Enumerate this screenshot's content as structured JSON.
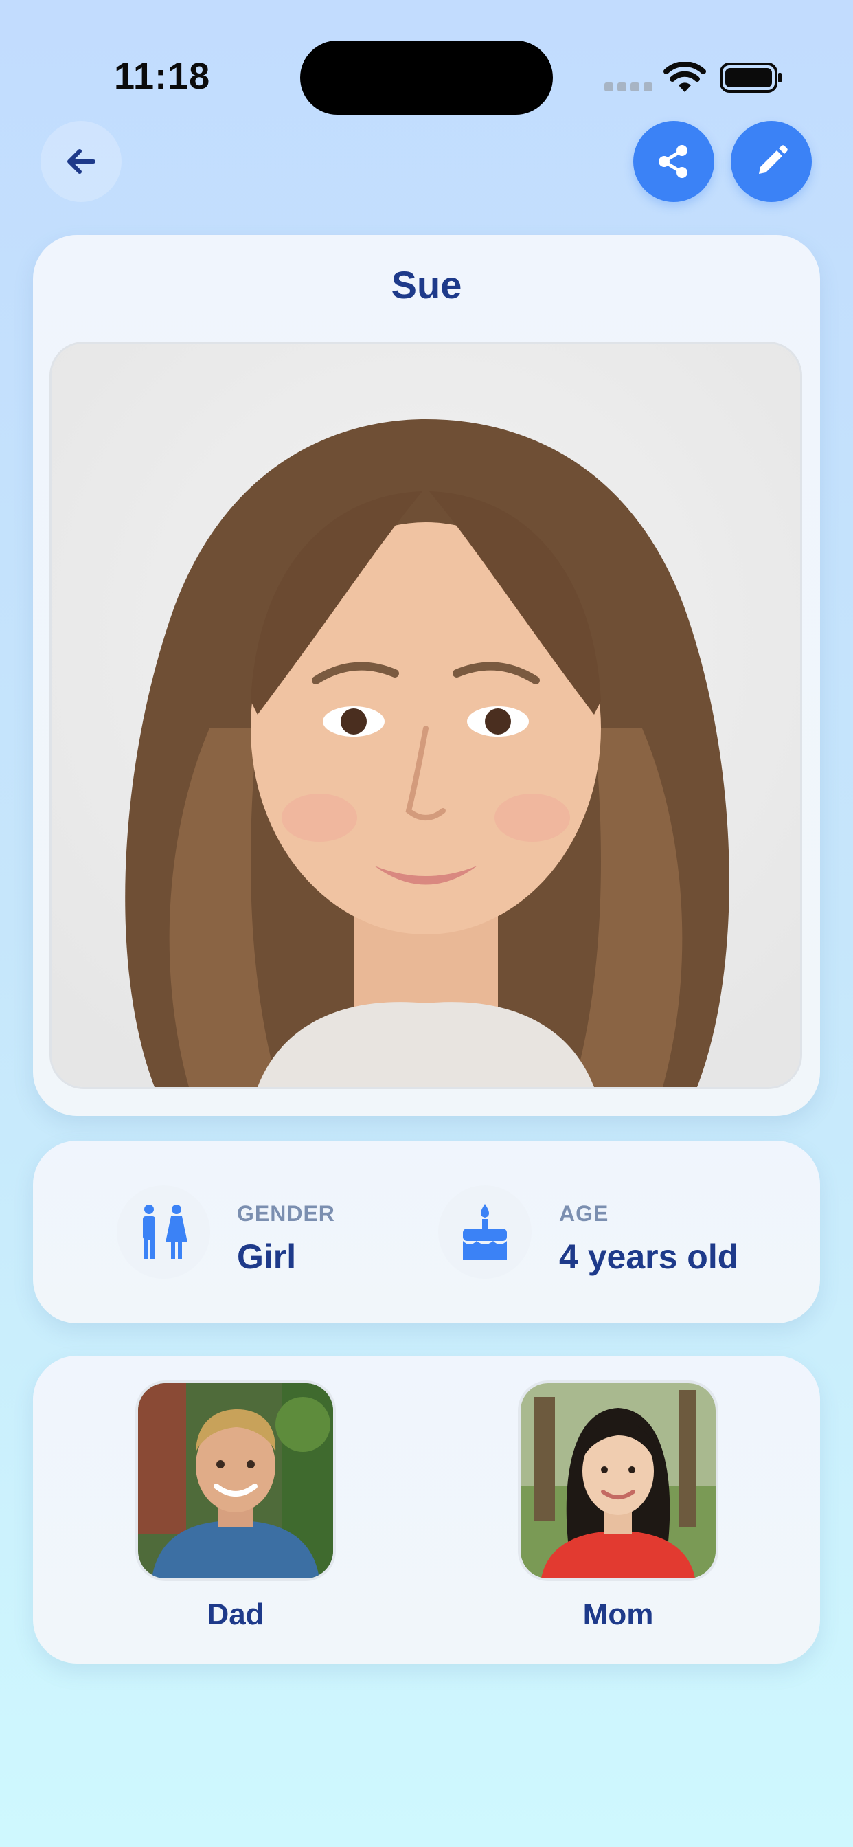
{
  "status_bar": {
    "time": "11:18"
  },
  "child": {
    "name": "Sue"
  },
  "info": {
    "gender_label": "GENDER",
    "gender_value": "Girl",
    "age_label": "AGE",
    "age_value": "4 years old"
  },
  "parents": [
    {
      "label": "Dad"
    },
    {
      "label": "Mom"
    }
  ],
  "icons": {
    "back": "arrow-left-icon",
    "share": "share-icon",
    "edit": "pencil-icon",
    "gender": "gender-icon",
    "age": "cake-icon"
  },
  "colors": {
    "accent": "#3b82f6",
    "text_primary": "#1e3a8a",
    "label_muted": "#7b8fb0"
  }
}
